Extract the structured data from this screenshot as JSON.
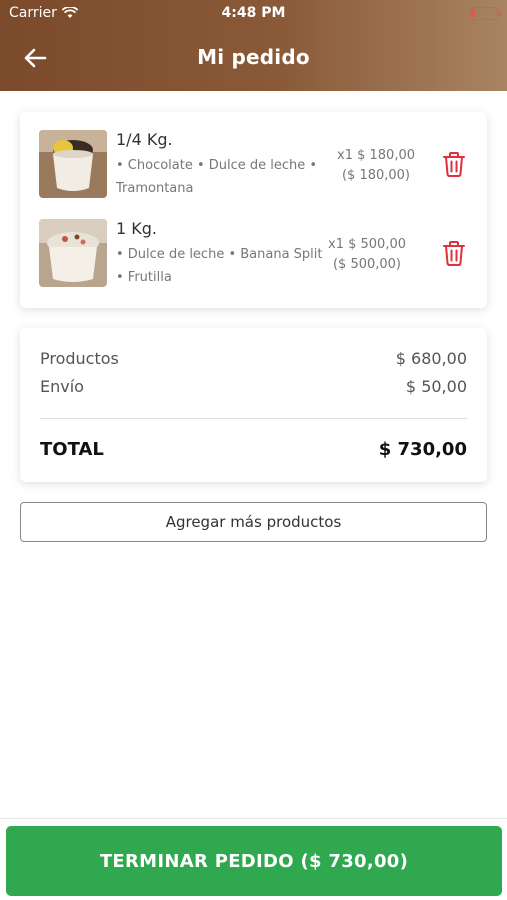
{
  "status_bar": {
    "carrier": "Carrier",
    "time": "4:48 PM"
  },
  "header": {
    "title": "Mi pedido"
  },
  "order_items": [
    {
      "size": "1/4 Kg.",
      "description": "• Chocolate • Dulce de leche • Tramontana",
      "qty_unit_price": "x1 $ 180,00",
      "subtotal": "($ 180,00)"
    },
    {
      "size": "1 Kg.",
      "description": "• Dulce de leche • Banana Split • Frutilla",
      "qty_unit_price": "x1 $ 500,00",
      "subtotal": "($ 500,00)"
    }
  ],
  "summary": {
    "products_label": "Productos",
    "products_value": "$ 680,00",
    "shipping_label": "Envío",
    "shipping_value": "$ 50,00",
    "total_label": "TOTAL",
    "total_value": "$ 730,00"
  },
  "actions": {
    "add_more": "Agregar más productos",
    "finish": "TERMINAR PEDIDO ($ 730,00)"
  },
  "colors": {
    "header_brown": "#7a4a2b",
    "delete_red": "#e0303e",
    "primary_green": "#2fa84f"
  }
}
